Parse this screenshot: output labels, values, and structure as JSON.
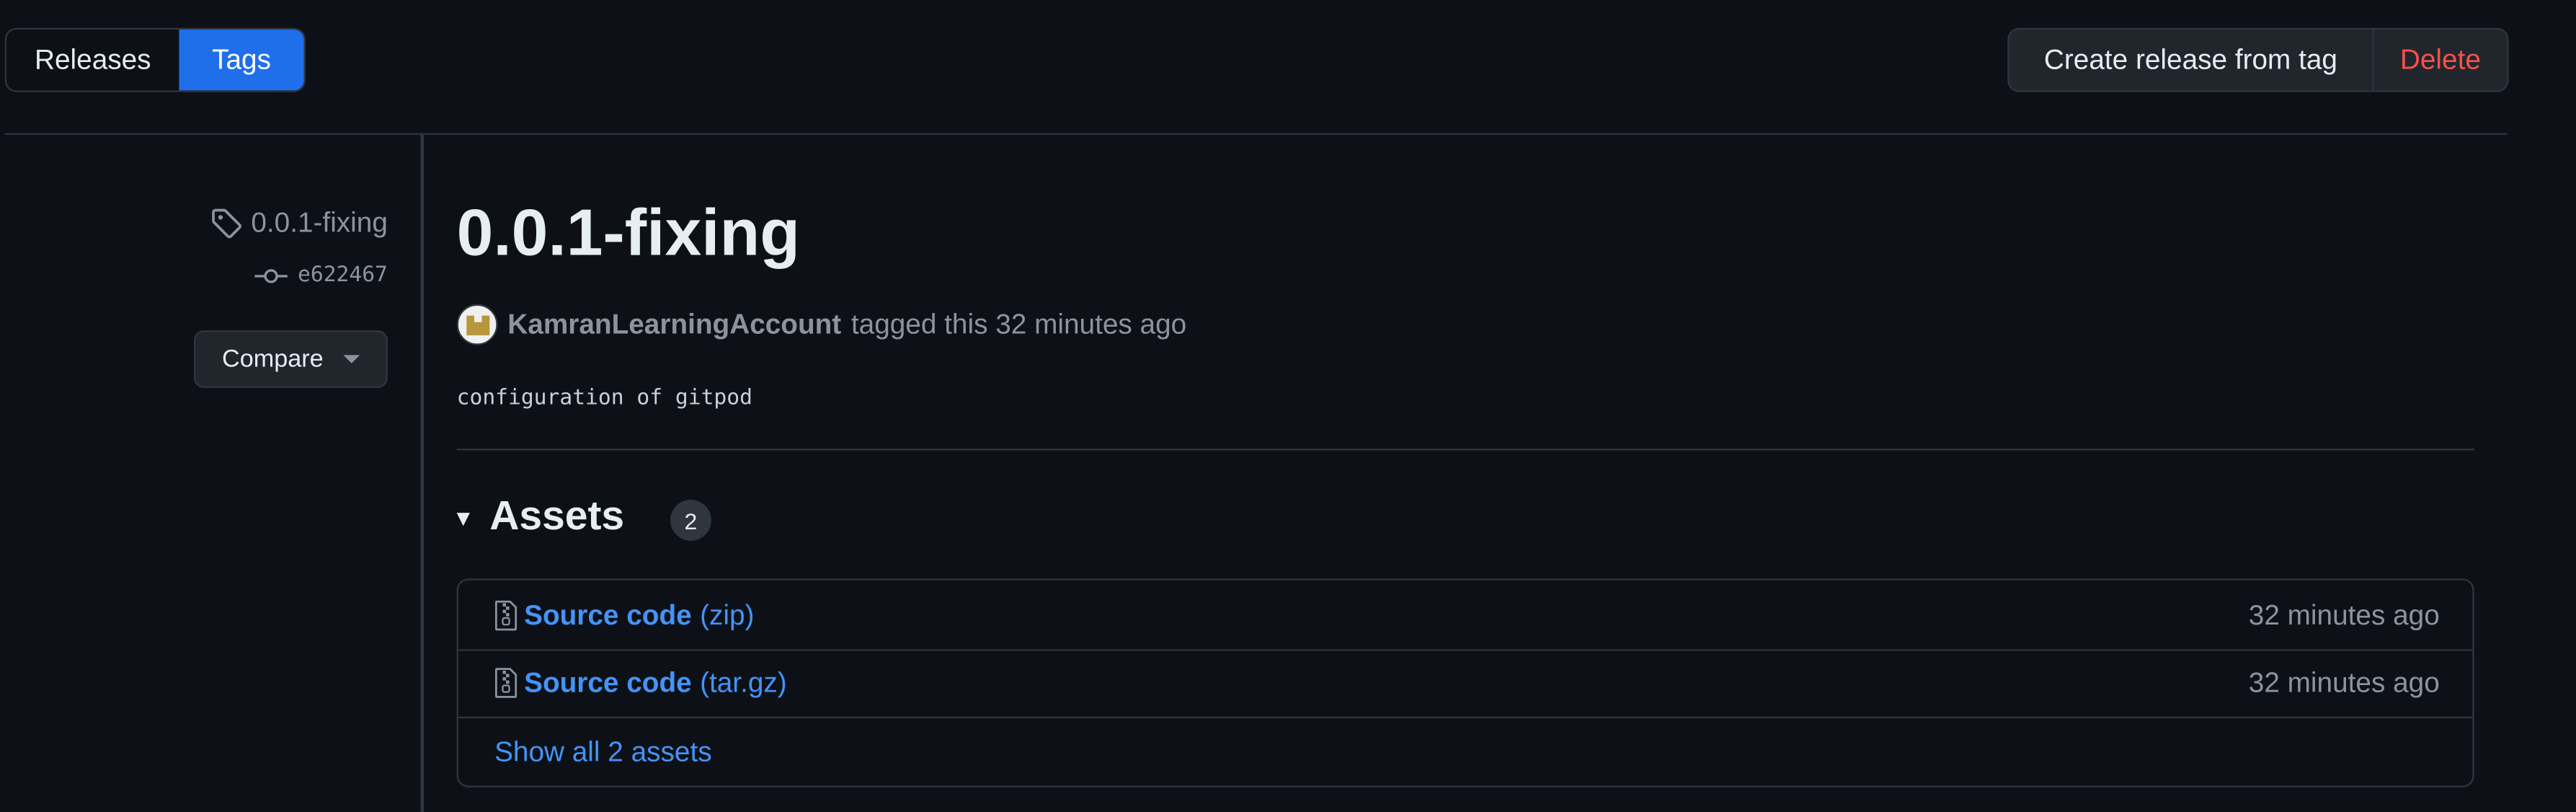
{
  "tabs": {
    "releases_label": "Releases",
    "tags_label": "Tags",
    "active": "Tags"
  },
  "actions": {
    "create_label": "Create release from tag",
    "delete_label": "Delete"
  },
  "sidebar": {
    "tag_name": "0.0.1-fixing",
    "commit_sha": "e622467",
    "compare_label": "Compare"
  },
  "release": {
    "title": "0.0.1-fixing",
    "author": "KamranLearningAccount",
    "tagged_text": "tagged this 32 minutes ago",
    "body": "configuration of gitpod"
  },
  "assets": {
    "heading": "Assets",
    "count": "2",
    "items": [
      {
        "name": "Source code",
        "ext": "(zip)",
        "time": "32 minutes ago"
      },
      {
        "name": "Source code",
        "ext": "(tar.gz)",
        "time": "32 minutes ago"
      }
    ],
    "show_all_label": "Show all 2 assets"
  },
  "colors": {
    "background": "#0d1117",
    "accent": "#1f6feb",
    "link": "#4493f8",
    "danger": "#f85149",
    "border": "#30363d",
    "muted": "#8b949e"
  }
}
